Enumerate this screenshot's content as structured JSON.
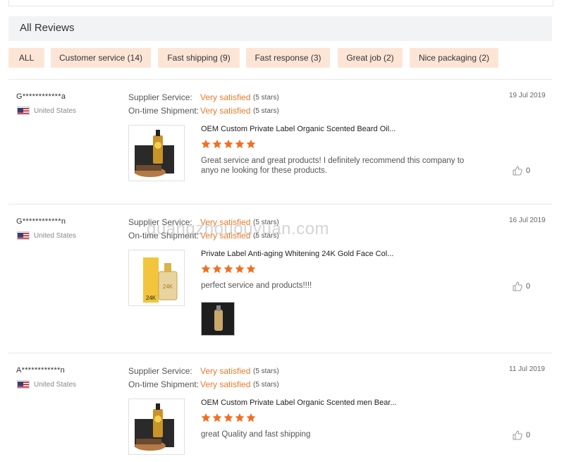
{
  "section": {
    "title": "All Reviews"
  },
  "filters": [
    {
      "label": "ALL"
    },
    {
      "label": "Customer service (14)"
    },
    {
      "label": "Fast shipping (9)"
    },
    {
      "label": "Fast response (3)"
    },
    {
      "label": "Great job (2)"
    },
    {
      "label": "Nice packaging (2)"
    }
  ],
  "labels": {
    "supplier_service": "Supplier Service:",
    "on_time_shipment": "On-time Shipment:"
  },
  "reviews": [
    {
      "user": "G************a",
      "country": "United States",
      "supplier_rating": "Very satisfied",
      "supplier_stars": "(5 stars)",
      "shipment_rating": "Very satisfied",
      "shipment_stars": "(5 stars)",
      "date": "19 Jul 2019",
      "product_title": "OEM Custom Private Label Organic Scented Beard Oil...",
      "rating": 5,
      "text": "Great service and great products! I definitely recommend this company to anyo ne looking for these products.",
      "helpful_count": "0"
    },
    {
      "user": "G************n",
      "country": "United States",
      "supplier_rating": "Very satisfied",
      "supplier_stars": "(5 stars)",
      "shipment_rating": "Very satisfied",
      "shipment_stars": "(5 stars)",
      "date": "16 Jul 2019",
      "product_title": "Private Label Anti-aging Whitening 24K Gold Face Col...",
      "rating": 5,
      "text": "perfect service and products!!!!",
      "helpful_count": "0"
    },
    {
      "user": "A************n",
      "country": "United States",
      "supplier_rating": "Very satisfied",
      "supplier_stars": "(5 stars)",
      "shipment_rating": "Very satisfied",
      "shipment_stars": "(5 stars)",
      "date": "11 Jul 2019",
      "product_title": "OEM Custom Private Label Organic Scented men Bear...",
      "rating": 5,
      "text": "great Quality and fast shipping",
      "helpful_count": "0"
    }
  ],
  "watermark": "guangzhououyuan.com",
  "colors": {
    "accent": "#e8792b",
    "tag_bg": "#fde5d6",
    "star": "#f26f21"
  },
  "icons": {
    "star": "star-icon",
    "like": "thumbs-up-icon",
    "flag": "us-flag-icon"
  }
}
